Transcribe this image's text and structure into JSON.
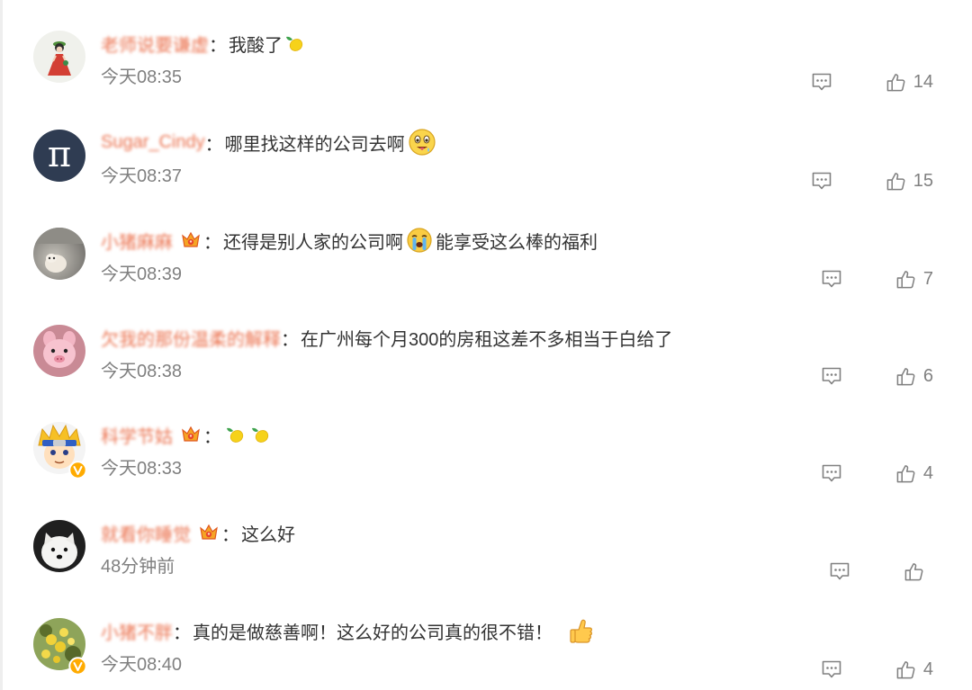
{
  "colors": {
    "username": "#eb7350",
    "comment_text": "#333333",
    "meta": "#808080",
    "verified_badge": "#ffab00",
    "fan_crown": "#f5a524"
  },
  "comments": [
    {
      "avatar": "avatar-girl-red-dress",
      "verified": false,
      "name": "老师说要谦虚",
      "fan_badge": false,
      "separator": "：",
      "segments": [
        {
          "text": "我酸了"
        },
        {
          "icon": "lemon-icon"
        }
      ],
      "time": "今天08:35",
      "likes": "14"
    },
    {
      "avatar": "avatar-pi-symbol",
      "avatar_text": "π",
      "verified": false,
      "name": "Sugar_Cindy",
      "fan_badge": false,
      "separator": "：",
      "segments": [
        {
          "text": "哪里找这样的公司去啊"
        },
        {
          "icon": "drooling-face-icon"
        }
      ],
      "time": "今天08:37",
      "likes": "15"
    },
    {
      "avatar": "avatar-puppy-photo",
      "verified": false,
      "name": "小猪麻麻",
      "fan_badge": true,
      "separator": "：",
      "segments": [
        {
          "text": "还得是别人家的公司啊"
        },
        {
          "icon": "crying-face-icon"
        },
        {
          "text": "能享受这么棒的福利"
        }
      ],
      "time": "今天08:39",
      "likes": "7"
    },
    {
      "avatar": "avatar-pink-plush-toy",
      "verified": false,
      "name": "欠我的那份温柔的解释",
      "fan_badge": false,
      "separator": "：",
      "segments": [
        {
          "text": "在广州每个月300的房租这差不多相当于白给了"
        }
      ],
      "time": "今天08:38",
      "likes": "6"
    },
    {
      "avatar": "avatar-cartoon-ninja",
      "verified": true,
      "name": "科学节姑",
      "fan_badge": true,
      "separator": "：",
      "segments": [
        {
          "icon": "lemon-icon"
        },
        {
          "icon": "lemon-icon"
        }
      ],
      "time": "今天08:33",
      "likes": "4"
    },
    {
      "avatar": "avatar-white-dog",
      "verified": false,
      "name": "就看你睡觉",
      "fan_badge": true,
      "separator": "：",
      "segments": [
        {
          "text": "这么好"
        }
      ],
      "time": "48分钟前"
    },
    {
      "avatar": "avatar-yellow-flowers",
      "verified": true,
      "name": "小猪不胖",
      "fan_badge": false,
      "separator": "：",
      "segments": [
        {
          "text": "真的是做慈善啊！这么好的公司真的很不错！"
        },
        {
          "icon": "thumbs-up-emoji-icon",
          "spaced": true
        }
      ],
      "time": "今天08:40",
      "likes": "4"
    }
  ]
}
